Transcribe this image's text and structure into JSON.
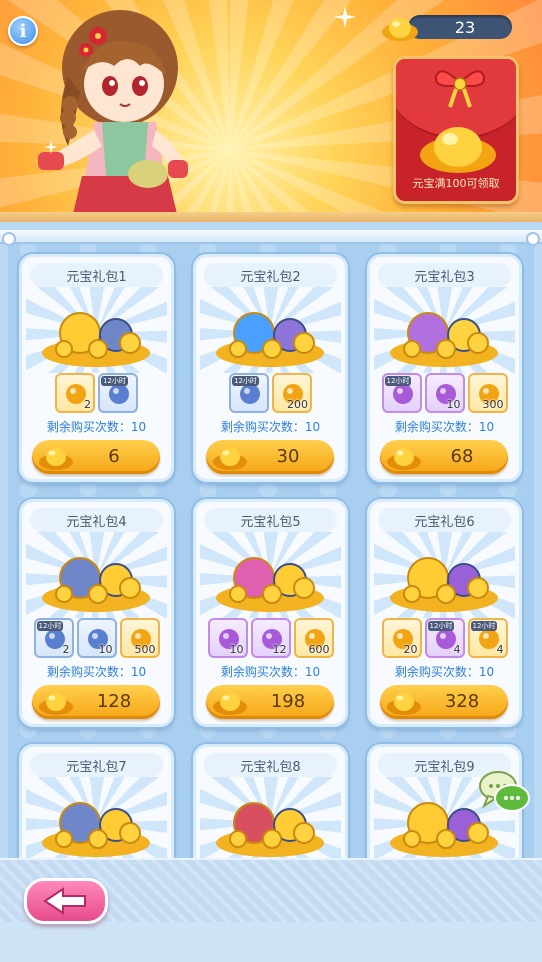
{
  "header": {
    "info_icon": "info-icon",
    "currency_icon": "gold-ingot-icon",
    "currency_amount": "23",
    "redpack": {
      "caption": "元宝满100可领取",
      "icon": "red-envelope-icon"
    }
  },
  "packs": [
    {
      "title": "元宝礼包1",
      "remaining": "剩余购买次数：10",
      "price": "6",
      "items": [
        {
          "q": "2",
          "tag": "",
          "kind": "gold"
        },
        {
          "q": "",
          "tag": "12小时",
          "kind": "blue"
        }
      ]
    },
    {
      "title": "元宝礼包2",
      "remaining": "剩余购买次数：10",
      "price": "30",
      "items": [
        {
          "q": "",
          "tag": "12小时",
          "kind": "blue"
        },
        {
          "q": "200",
          "tag": "",
          "kind": "gold"
        }
      ]
    },
    {
      "title": "元宝礼包3",
      "remaining": "剩余购买次数：10",
      "price": "68",
      "items": [
        {
          "q": "",
          "tag": "12小时",
          "kind": "purple"
        },
        {
          "q": "10",
          "tag": "",
          "kind": "purple"
        },
        {
          "q": "300",
          "tag": "",
          "kind": "gold"
        }
      ]
    },
    {
      "title": "元宝礼包4",
      "remaining": "剩余购买次数：10",
      "price": "128",
      "items": [
        {
          "q": "2",
          "tag": "12小时",
          "kind": "blue"
        },
        {
          "q": "10",
          "tag": "",
          "kind": "blue"
        },
        {
          "q": "500",
          "tag": "",
          "kind": "gold"
        }
      ]
    },
    {
      "title": "元宝礼包5",
      "remaining": "剩余购买次数：10",
      "price": "198",
      "items": [
        {
          "q": "10",
          "tag": "",
          "kind": "purple"
        },
        {
          "q": "12",
          "tag": "",
          "kind": "purple"
        },
        {
          "q": "600",
          "tag": "",
          "kind": "gold"
        }
      ]
    },
    {
      "title": "元宝礼包6",
      "remaining": "剩余购买次数：10",
      "price": "328",
      "items": [
        {
          "q": "20",
          "tag": "",
          "kind": "gold"
        },
        {
          "q": "4",
          "tag": "12小时",
          "kind": "purple"
        },
        {
          "q": "4",
          "tag": "12小时",
          "kind": "gold"
        }
      ]
    },
    {
      "title": "元宝礼包7"
    },
    {
      "title": "元宝礼包8"
    },
    {
      "title": "元宝礼包9"
    }
  ],
  "footer": {
    "back_icon": "back-arrow-icon",
    "chat_icon": "chat-bubbles-icon"
  }
}
